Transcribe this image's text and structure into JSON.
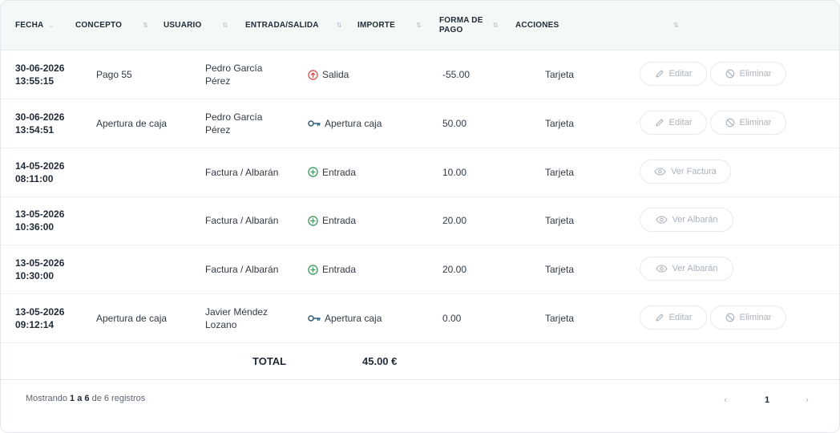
{
  "table": {
    "headers": {
      "fecha": "FECHA",
      "concepto": "CONCEPTO",
      "usuario": "USUARIO",
      "entrada_salida": "ENTRADA/SALIDA",
      "importe": "IMPORTE",
      "forma_pago_1": "FORMA DE",
      "forma_pago_2": "PAGO",
      "acciones": "ACCIONES"
    },
    "rows": [
      {
        "date": "30-06-2026",
        "time": "13:55:15",
        "concepto": "Pago 55",
        "user1": "Pedro García",
        "user2": "Pérez",
        "type": "Salida",
        "type_icon": "arrow-up-circle-icon",
        "importe": "-55.00",
        "forma": "Tarjeta",
        "actions": [
          "Editar",
          "Eliminar"
        ]
      },
      {
        "date": "30-06-2026",
        "time": "13:54:51",
        "concepto": "Apertura de caja",
        "user1": "Pedro García",
        "user2": "Pérez",
        "type": "Apertura caja",
        "type_icon": "key-icon",
        "importe": "50.00",
        "forma": "Tarjeta",
        "actions": [
          "Editar",
          "Eliminar"
        ]
      },
      {
        "date": "14-05-2026",
        "time": "08:11:00",
        "concepto": "",
        "user1": "Factura / Albarán",
        "user2": "",
        "type": "Entrada",
        "type_icon": "plus-circle-icon",
        "importe": "10.00",
        "forma": "Tarjeta",
        "actions": [
          "Ver Factura"
        ]
      },
      {
        "date": "13-05-2026",
        "time": "10:36:00",
        "concepto": "",
        "user1": "Factura / Albarán",
        "user2": "",
        "type": "Entrada",
        "type_icon": "plus-circle-icon",
        "importe": "20.00",
        "forma": "Tarjeta",
        "actions": [
          "Ver Albarán"
        ]
      },
      {
        "date": "13-05-2026",
        "time": "10:30:00",
        "concepto": "",
        "user1": "Factura / Albarán",
        "user2": "",
        "type": "Entrada",
        "type_icon": "plus-circle-icon",
        "importe": "20.00",
        "forma": "Tarjeta",
        "actions": [
          "Ver Albarán"
        ]
      },
      {
        "date": "13-05-2026",
        "time": "09:12:14",
        "concepto": "Apertura de caja",
        "user1": "Javier Méndez",
        "user2": "Lozano",
        "type": "Apertura caja",
        "type_icon": "key-icon",
        "importe": "0.00",
        "forma": "Tarjeta",
        "actions": [
          "Editar",
          "Eliminar"
        ]
      }
    ],
    "total_label": "TOTAL",
    "total_value": "45.00 €"
  },
  "footer": {
    "prefix": "Mostrando",
    "range": "1 a 6",
    "middle": "de 6 registros",
    "page": "1",
    "prev": "‹",
    "next": "›"
  },
  "colors": {
    "salida": "#d9534f",
    "entrada": "#3a9b5c",
    "key": "#2f5d77"
  }
}
